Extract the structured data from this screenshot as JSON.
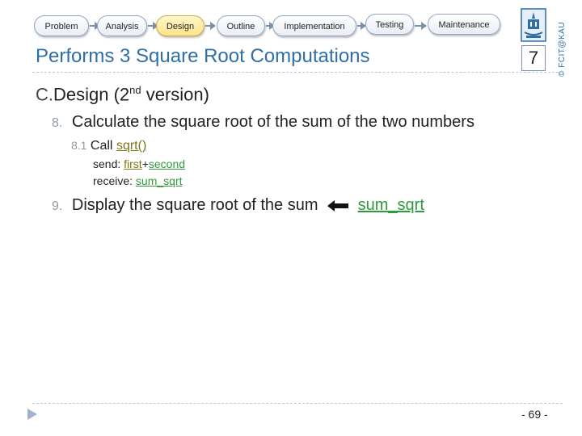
{
  "nav": {
    "steps": [
      {
        "label": "Problem"
      },
      {
        "label": "Analysis"
      },
      {
        "label": "Design"
      },
      {
        "label": "Outline"
      },
      {
        "label": "Implementation"
      },
      {
        "label": "Testing"
      },
      {
        "label": "Maintenance"
      }
    ],
    "active_step": "Design"
  },
  "header": {
    "title": "Performs 3 Square Root Computations",
    "slide_badge": "7",
    "copyright": "© FCIT@KAU",
    "logo_icon": "university-logo-icon"
  },
  "content": {
    "heading_prefix": "C.",
    "heading_text": "Design (2",
    "heading_sup": "nd",
    "heading_suffix": " version)",
    "step8_num": "8.",
    "step8_text": "Calculate the square root of the sum of the two numbers",
    "step81_num": "8.1",
    "step81_call": "Call",
    "step81_func": "sqrt()",
    "send_label": "send:",
    "send_first": "first",
    "send_plus": "+",
    "send_second": "second",
    "receive_label": "receive:",
    "receive_value": "sum_sqrt",
    "step9_num": "9.",
    "step9_text": "Display the square root of the sum",
    "step9_arrow_icon": "left-arrow-icon",
    "step9_value": "sum_sqrt"
  },
  "footer": {
    "page": "- 69 -",
    "bullet_icon": "triangle-bullet-icon"
  },
  "colors": {
    "title": "#2f6fa5",
    "green": "#2f9a3c",
    "olive": "#7c7418",
    "active_pill": "#fde38a"
  }
}
